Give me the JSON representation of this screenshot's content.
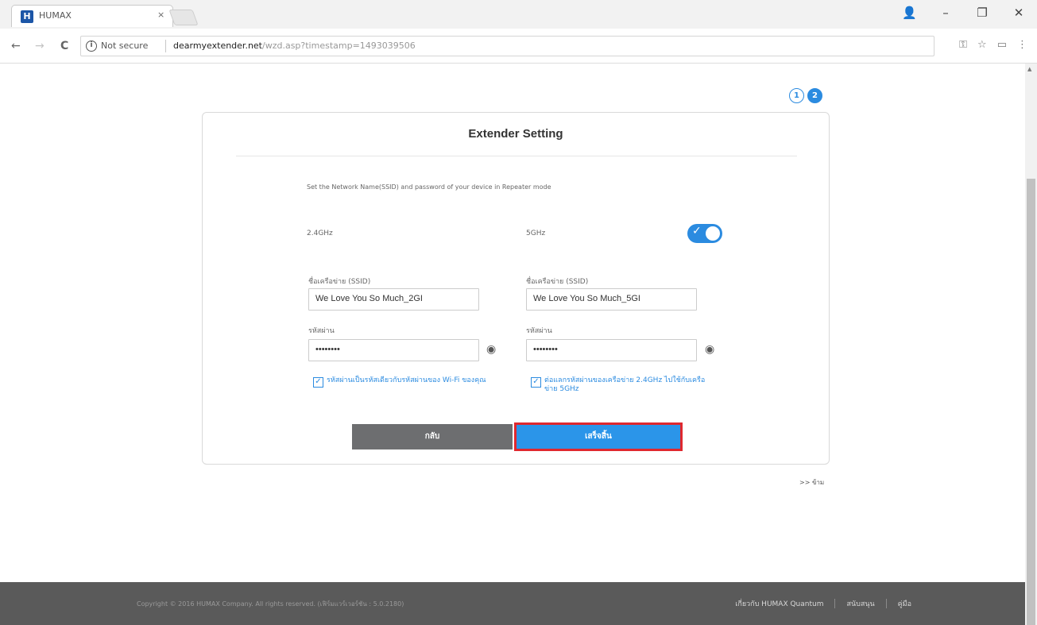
{
  "browser": {
    "tab_title": "HUMAX",
    "tab_favicon_letter": "H",
    "tab_close": "×",
    "not_secure": "Not secure",
    "url_host": "dearmyextender.net",
    "url_path": "/wzd.asp?timestamp=1493039506",
    "window_controls": {
      "profile": "👤",
      "minimize": "–",
      "maximize": "❐",
      "close": "✕"
    },
    "nav": {
      "back": "←",
      "forward": "→",
      "reload": "C"
    },
    "right_icons": {
      "key": "⚿",
      "star": "☆",
      "cast": "▭",
      "menu": "⋮"
    },
    "info_icon": "i"
  },
  "steps": [
    "1",
    "2"
  ],
  "card": {
    "title": "Extender Setting",
    "description": "Set the Network Name(SSID) and password of your device in Repeater mode",
    "band_24": {
      "label": "2.4GHz",
      "ssid_label": "ชื่อเครือข่าย (SSID)",
      "ssid_value": "We Love You So Much_2GI",
      "password_label": "รหัสผ่าน",
      "password_value": "••••••••",
      "checkbox_text": "รหัสผ่านเป็นรหัสเดียวกับรหัสผ่านของ Wi-Fi ของคุณ"
    },
    "band_5": {
      "label": "5GHz",
      "ssid_label": "ชื่อเครือข่าย (SSID)",
      "ssid_value": "We Love You So Much_5GI",
      "password_label": "รหัสผ่าน",
      "password_value": "••••••••",
      "checkbox_text": "ต่อแลกรหัสผ่านของเครือข่าย 2.4GHz ไปใช้กับเครือข่าย 5GHz"
    },
    "toggle_5ghz_on": true,
    "toggle_check": "✓",
    "checkbox_mark": "✓",
    "eye_icon": "◉",
    "back_button": "กลับ",
    "finish_button": "เสร็จสิ้น"
  },
  "skip_link": ">> ข้าม",
  "footer": {
    "copyright": "Copyright © 2016 HUMAX Company. All rights reserved. (เฟิร์มแวร์เวอร์ชัน : 5.0.2180)",
    "links": [
      "เกี่ยวกับ HUMAX Quantum",
      "สนับสนุน",
      "คู่มือ"
    ]
  },
  "colors": {
    "accent": "#2b8be0",
    "highlight_border": "#e0282e",
    "footer_bg": "#5a5a5a",
    "back_button": "#6d6e70"
  }
}
